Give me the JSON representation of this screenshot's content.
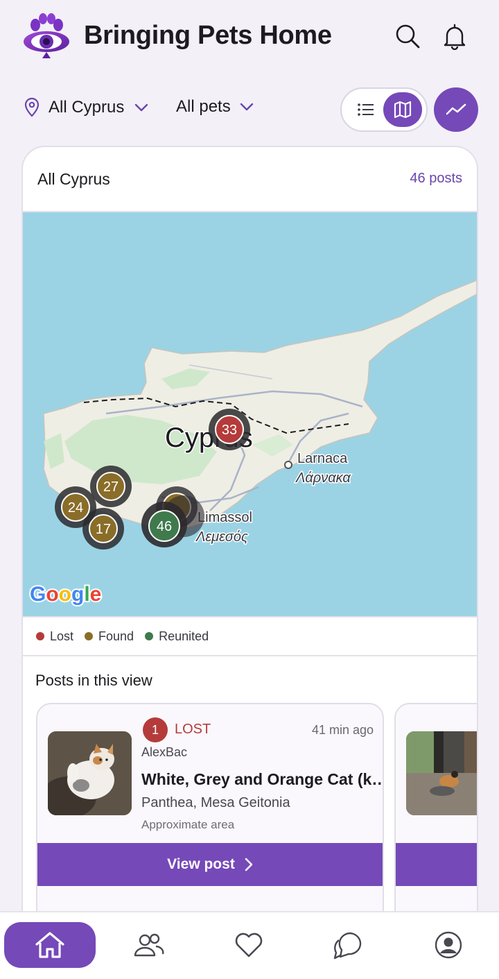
{
  "header": {
    "title": "Bringing Pets Home",
    "icons": [
      "search-icon",
      "bell-icon"
    ]
  },
  "filters": {
    "location_label": "All Cyprus",
    "pets_label": "All pets",
    "view_mode": "map"
  },
  "card": {
    "title": "All Cyprus",
    "post_count": "46 posts"
  },
  "map": {
    "country_label": "Cyprus",
    "city_labels": [
      {
        "en": "Larnaca",
        "gr": "Λάρνακα"
      },
      {
        "en": "Limassol",
        "gr": "Λεμεσός"
      }
    ],
    "clusters": [
      {
        "count": "33",
        "status": "lost"
      },
      {
        "count": "27",
        "status": "found"
      },
      {
        "count": "24",
        "status": "found"
      },
      {
        "count": "17",
        "status": "found"
      },
      {
        "count": "46",
        "status": "reunited"
      }
    ],
    "provider": "Google"
  },
  "legend": {
    "items": [
      {
        "label": "Lost",
        "color": "#b53b3b"
      },
      {
        "label": "Found",
        "color": "#8a6d28"
      },
      {
        "label": "Reunited",
        "color": "#3f7a4c"
      }
    ]
  },
  "posts": {
    "section_title": "Posts in this view",
    "items": [
      {
        "badge": "1",
        "status": "LOST",
        "time": "41 min ago",
        "author": "AlexBac",
        "title": "White, Grey and Orange Cat (k…",
        "location": "Panthea, Mesa Geitonia",
        "approx": "Approximate area",
        "button": "View post"
      }
    ]
  },
  "colors": {
    "accent": "#7549b8",
    "lost": "#b53b3b",
    "found": "#8a6d28",
    "reunited": "#3f7a4c"
  },
  "nav": {
    "items": [
      "home-icon",
      "people-icon",
      "heart-icon",
      "chat-icon",
      "profile-icon"
    ],
    "active": "home"
  }
}
